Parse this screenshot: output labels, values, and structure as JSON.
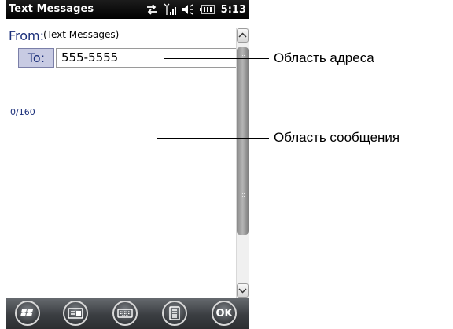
{
  "statusbar": {
    "title": "Text Messages",
    "time": "5:13",
    "icons": [
      "connectivity-icon",
      "signal-icon",
      "speaker-icon",
      "battery-icon"
    ]
  },
  "compose": {
    "from_label": "From:",
    "from_value": "(Text Messages)",
    "to_label": "To:",
    "to_value": "555-5555",
    "char_count": "0/160"
  },
  "toolbar": {
    "buttons": [
      "start-icon",
      "messaging-icon",
      "keyboard-icon",
      "menu-icon"
    ],
    "ok_label": "OK"
  },
  "callouts": {
    "address_area": "Область адреса",
    "message_area": "Область сообщения"
  },
  "colors": {
    "statusbar": "#000000",
    "label_blue": "#1b2f7a",
    "to_button_bg": "#c8cbe3",
    "toolbar": "#3b3e42"
  }
}
